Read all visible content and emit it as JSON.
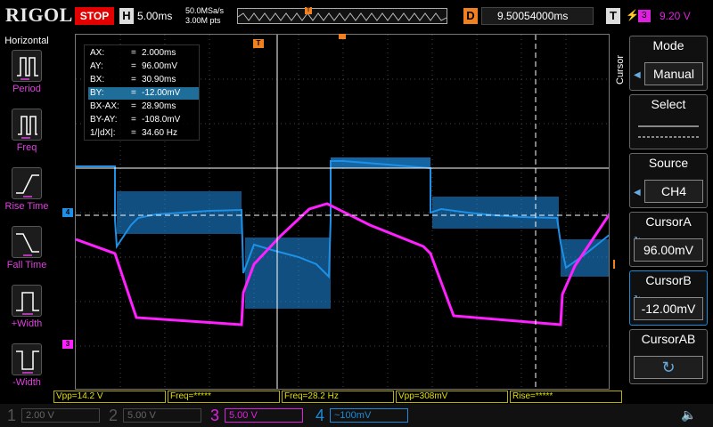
{
  "header": {
    "brand": "RIGOL",
    "run_state": "STOP",
    "timebase_key": "H",
    "timebase": "5.00ms",
    "sample_rate": "50.0MSa/s",
    "memory_depth": "3.00M pts",
    "delay_key": "D",
    "delay": "9.50054000ms",
    "trigger_key": "T",
    "trigger_channel": "3",
    "trigger_level": "9.20 V"
  },
  "left_panel": {
    "title": "Horizontal",
    "items": [
      {
        "label": "Period",
        "icon": "period-icon"
      },
      {
        "label": "Freq",
        "icon": "frequency-icon"
      },
      {
        "label": "Rise Time",
        "icon": "rise-time-icon"
      },
      {
        "label": "Fall Time",
        "icon": "fall-time-icon"
      },
      {
        "label": "+Width",
        "icon": "positive-width-icon"
      },
      {
        "label": "-Width",
        "icon": "negative-width-icon"
      }
    ]
  },
  "cursor_readout": [
    {
      "key": "AX:",
      "value": "2.000ms"
    },
    {
      "key": "AY:",
      "value": "96.00mV"
    },
    {
      "key": "BX:",
      "value": "30.90ms"
    },
    {
      "key": "BY:",
      "value": "-12.00mV"
    },
    {
      "key": "BX-AX:",
      "value": "28.90ms"
    },
    {
      "key": "BY-AY:",
      "value": "-108.0mV"
    },
    {
      "key": "1/|dX|:",
      "value": "34.60 Hz"
    }
  ],
  "cursor_readout_selected": 3,
  "right_panel": {
    "side_label": "Cursor",
    "mode": {
      "label": "Mode",
      "value": "Manual"
    },
    "select": {
      "label": "Select"
    },
    "source": {
      "label": "Source",
      "value": "CH4"
    },
    "cursor_a": {
      "label": "CursorA",
      "value": "96.00mV"
    },
    "cursor_b": {
      "label": "CursorB",
      "value": "-12.00mV"
    },
    "cursor_ab": {
      "label": "CursorAB"
    }
  },
  "measurements": [
    {
      "text": "Vpp=14.2 V"
    },
    {
      "text": "Freq=*****"
    },
    {
      "text": "Freq=28.2 Hz"
    },
    {
      "text": "Vpp=308mV"
    },
    {
      "text": "Rise=*****"
    }
  ],
  "channels": [
    {
      "num": "1",
      "scale": "2.00 V",
      "color": "#555555",
      "active": false
    },
    {
      "num": "2",
      "scale": "5.00 V",
      "color": "#555555",
      "active": false
    },
    {
      "num": "3",
      "scale": "5.00 V",
      "color": "#e020e0",
      "active": true
    },
    {
      "num": "4",
      "scale": "~100mV",
      "color": "#1e8ad8",
      "active": true
    }
  ],
  "markers": {
    "ch4": "4",
    "ch3": "3",
    "trigger": "T"
  },
  "colors": {
    "ch4": "#1e90e8",
    "ch3": "#ff20ff",
    "trigger": "#f08020",
    "cursor": "#ffffff"
  }
}
